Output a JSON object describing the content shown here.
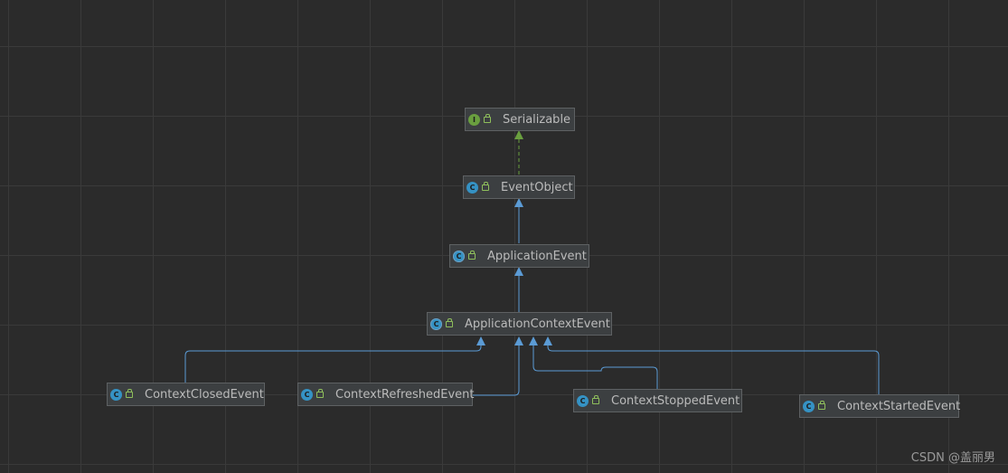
{
  "nodes": {
    "serializable": {
      "name": "Serializable",
      "kind": "interface",
      "badge": "I"
    },
    "event_object": {
      "name": "EventObject",
      "kind": "class",
      "badge": "C"
    },
    "application_event": {
      "name": "ApplicationEvent",
      "kind": "abstract",
      "badge": "C"
    },
    "application_context_event": {
      "name": "ApplicationContextEvent",
      "kind": "abstract",
      "badge": "C"
    },
    "context_closed_event": {
      "name": "ContextClosedEvent",
      "kind": "class",
      "badge": "C"
    },
    "context_refreshed_event": {
      "name": "ContextRefreshedEvent",
      "kind": "class",
      "badge": "C"
    },
    "context_stopped_event": {
      "name": "ContextStoppedEvent",
      "kind": "class",
      "badge": "C"
    },
    "context_started_event": {
      "name": "ContextStartedEvent",
      "kind": "class",
      "badge": "C"
    }
  },
  "edges": [
    {
      "from": "event_object",
      "to": "serializable",
      "type": "implements"
    },
    {
      "from": "application_event",
      "to": "event_object",
      "type": "extends"
    },
    {
      "from": "application_context_event",
      "to": "application_event",
      "type": "extends"
    },
    {
      "from": "context_closed_event",
      "to": "application_context_event",
      "type": "extends"
    },
    {
      "from": "context_refreshed_event",
      "to": "application_context_event",
      "type": "extends"
    },
    {
      "from": "context_stopped_event",
      "to": "application_context_event",
      "type": "extends"
    },
    {
      "from": "context_started_event",
      "to": "application_context_event",
      "type": "extends"
    }
  ],
  "colors": {
    "background": "#2b2b2b",
    "extends_edge": "#5b9bd5",
    "implements_edge": "#6a9f3f"
  },
  "watermark": "CSDN @盖丽男"
}
